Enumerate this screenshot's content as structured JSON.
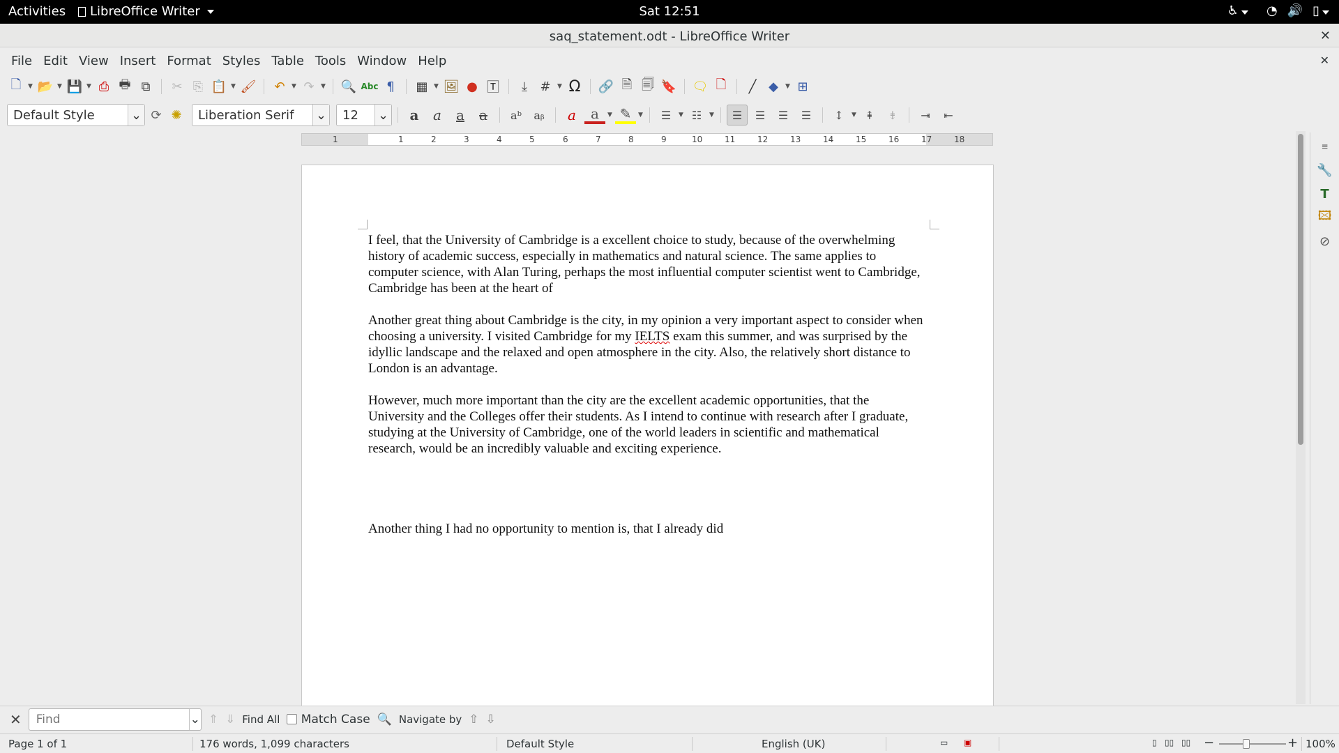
{
  "topbar": {
    "activities": "Activities",
    "app_menu": "LibreOffice Writer",
    "clock": "Sat 12:51"
  },
  "window": {
    "title": "saq_statement.odt - LibreOffice Writer"
  },
  "menu": {
    "items": [
      "File",
      "Edit",
      "View",
      "Insert",
      "Format",
      "Styles",
      "Table",
      "Tools",
      "Window",
      "Help"
    ]
  },
  "format_bar": {
    "paragraph_style": "Default Style",
    "font_name": "Liberation Serif",
    "font_size": "12"
  },
  "ruler": {
    "ticks": [
      "1",
      "1",
      "2",
      "3",
      "4",
      "5",
      "6",
      "7",
      "8",
      "9",
      "10",
      "11",
      "12",
      "13",
      "14",
      "15",
      "16",
      "17",
      "18"
    ]
  },
  "document": {
    "paragraphs": [
      "I feel, that the University of Cambridge is a excellent choice to study, because of the overwhelming history of academic success, especially in mathematics and natural science. The same applies to computer science, with Alan Turing, perhaps the most influential computer scientist went to Cambridge, Cambridge has been at the heart of",
      "Another great thing about Cambridge is the city, in my opinion a very important aspect to consider when choosing a university. I visited Cambridge for my ",
      "However, much more important than the city are the excellent academic opportunities, that the University and the Colleges offer their students. As I intend to continue with research after I graduate, studying at the University of Cambridge, one of the world leaders in scientific and mathematical research, would be an incredibly valuable and exciting experience.",
      "Another thing I had no opportunity to mention is, that I already did"
    ],
    "para2_misspelled": "IELTS",
    "para2_rest": " exam this summer, and was surprised by the idyllic landscape and the relaxed and open atmosphere in the city. Also, the relatively short distance to London is an advantage."
  },
  "findbar": {
    "placeholder": "Find",
    "find_all": "Find All",
    "match_case": "Match Case",
    "navigate_by": "Navigate by"
  },
  "status": {
    "page": "Page 1 of 1",
    "words": "176 words, 1,099 characters",
    "style": "Default Style",
    "language": "English (UK)",
    "zoom": "100%"
  }
}
